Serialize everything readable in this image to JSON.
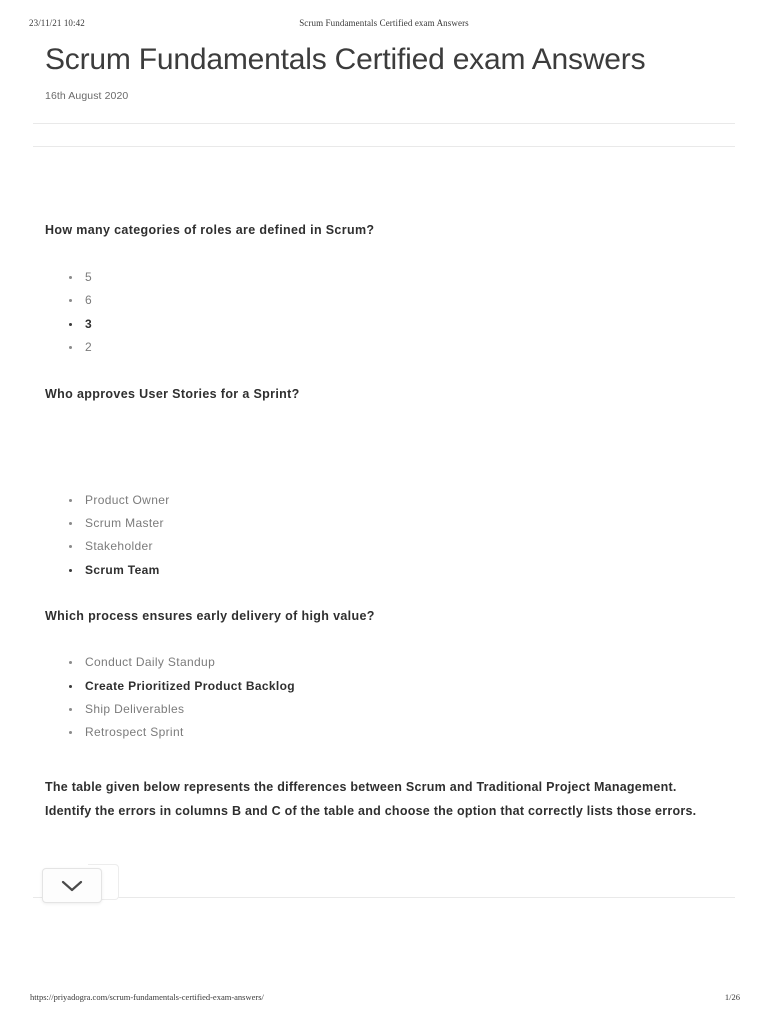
{
  "print_header": {
    "datetime": "23/11/21 10:42",
    "document_title": "Scrum Fundamentals Certified exam Answers"
  },
  "print_footer": {
    "url": "https://priyadogra.com/scrum-fundamentals-certified-exam-answers/",
    "page_indicator": "1/26"
  },
  "article": {
    "title": "Scrum Fundamentals Certified exam Answers",
    "date": "16th August 2020",
    "questions": [
      {
        "text": "How many categories of roles are defined in Scrum?",
        "options": [
          {
            "label": "5",
            "correct": false
          },
          {
            "label": "6",
            "correct": false
          },
          {
            "label": "3",
            "correct": true
          },
          {
            "label": "2",
            "correct": false
          }
        ]
      },
      {
        "text": "Who approves User Stories for a Sprint?",
        "options": [
          {
            "label": "Product Owner",
            "correct": false
          },
          {
            "label": "Scrum Master",
            "correct": false
          },
          {
            "label": "Stakeholder",
            "correct": false
          },
          {
            "label": "Scrum Team",
            "correct": true
          }
        ]
      },
      {
        "text": "Which process ensures early delivery of high value?",
        "options": [
          {
            "label": "Conduct Daily Standup",
            "correct": false
          },
          {
            "label": "Create Prioritized Product Backlog",
            "correct": true
          },
          {
            "label": "Ship Deliverables",
            "correct": false
          },
          {
            "label": "Retrospect Sprint",
            "correct": false
          }
        ]
      },
      {
        "text": "The table given below represents the differences between Scrum and Traditional Project Management. Identify the errors in columns B and C of the table and choose the option that correctly lists those errors.",
        "options": []
      }
    ]
  },
  "overlay": {
    "icon": "chevron-down-icon"
  },
  "colors": {
    "text_primary": "#2f2f2f",
    "text_muted": "#7b7b7b",
    "title": "#3c3c3c",
    "rule": "#e9e9e9"
  }
}
